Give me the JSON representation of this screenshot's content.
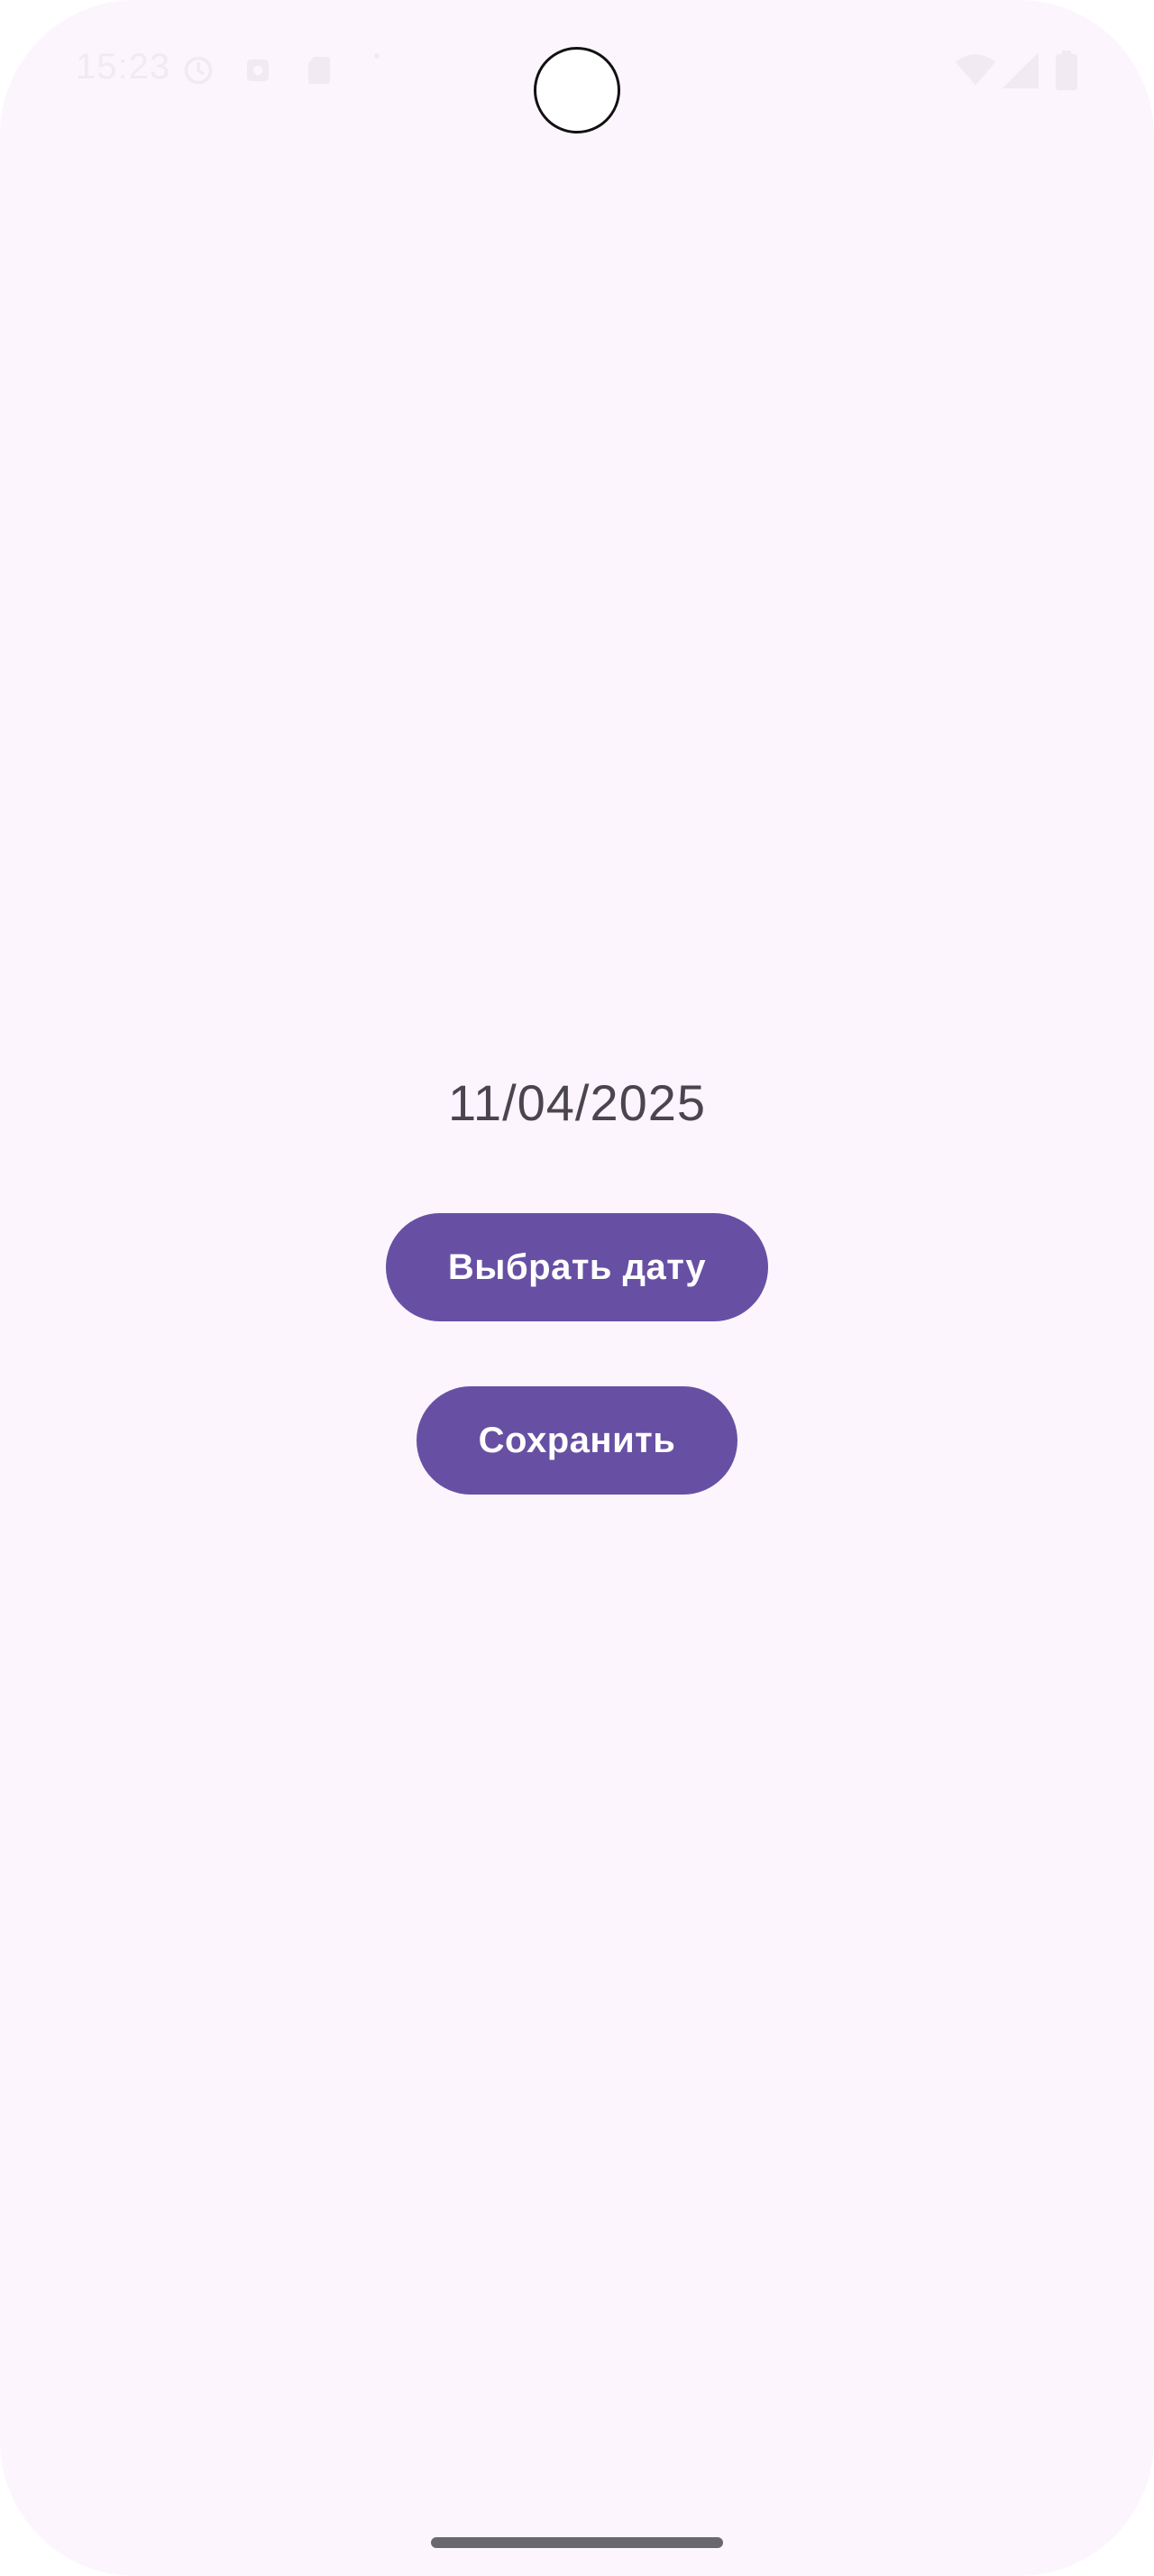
{
  "status_bar": {
    "time": "15:23",
    "icons": [
      "clock-icon",
      "sync-icon",
      "sd-card-icon",
      "notification-dot-icon",
      "wifi-icon",
      "signal-icon",
      "battery-icon"
    ]
  },
  "main": {
    "selected_date": "11/04/2025",
    "pick_date_label": "Выбрать дату",
    "save_label": "Сохранить"
  },
  "colors": {
    "background": "#FCF5FD",
    "button": "#6750A4",
    "button_text": "#FFFFFF",
    "date_text": "#4A454E",
    "nav_handle": "#6B676E"
  }
}
